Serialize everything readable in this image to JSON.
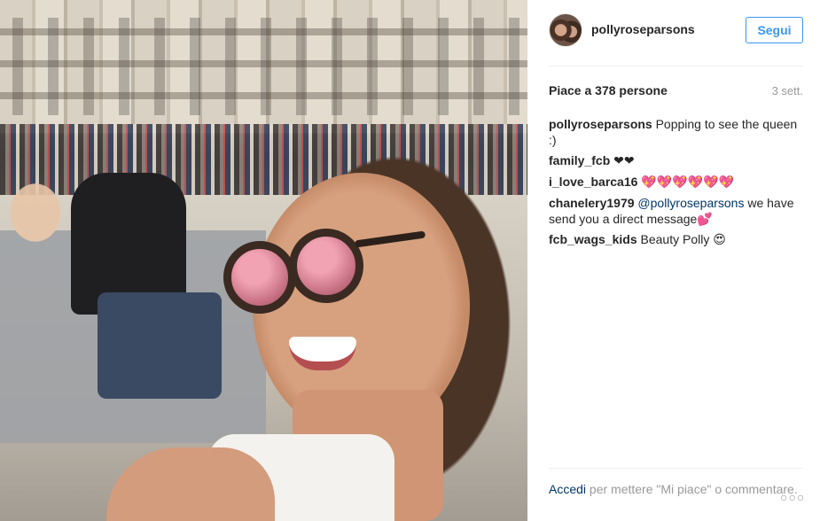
{
  "post": {
    "username": "pollyroseparsons",
    "follow_label": "Segui",
    "likes": "Piace a 378 persone",
    "time": "3 sett.",
    "comments": [
      {
        "user": "pollyroseparsons",
        "text": "Popping to see the queen :)"
      },
      {
        "user": "family_fcb",
        "text": "❤❤"
      },
      {
        "user": "i_love_barca16",
        "text": "💖💖💖💖💖💖"
      },
      {
        "user": "chanelery1979",
        "mention": "@pollyroseparsons",
        "text": " we have send you a direct message💕"
      },
      {
        "user": "fcb_wags_kids",
        "text": "Beauty Polly 😍"
      }
    ],
    "footer": {
      "login": "Accedi",
      "text": " per mettere \"Mi piace\" o commentare."
    },
    "more_label": "○○○"
  },
  "colors": {
    "accent": "#3897f0",
    "link": "#003569",
    "muted": "#999999"
  }
}
